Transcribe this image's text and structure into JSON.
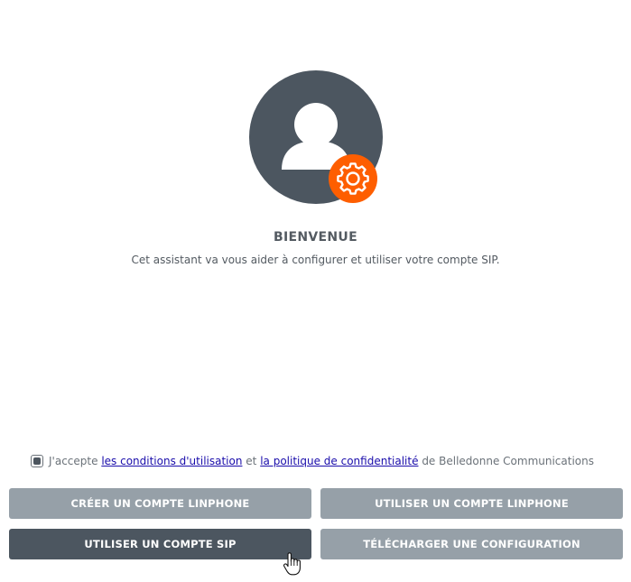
{
  "welcome": {
    "title": "BIENVENUE",
    "subtitle": "Cet assistant va vous aider à configurer et utiliser votre compte SIP."
  },
  "icons": {
    "avatar": "user-avatar-icon",
    "badge": "gear-icon",
    "cursor": "hand-pointer-icon"
  },
  "colors": {
    "avatar_bg": "#4c5660",
    "badge_orange": "#fe5e00",
    "button_light": "#96a0a8",
    "button_dark": "#4c5660",
    "link": "#1a0dab"
  },
  "terms": {
    "checked": true,
    "prefix": "J'accepte",
    "link1": "les conditions d'utilisation",
    "and": "et",
    "link2": "la politique de confidentialité",
    "suffix": "de Belledonne Communications"
  },
  "buttons": {
    "create_linphone": "CRÉER UN COMPTE LINPHONE",
    "use_linphone": "UTILISER UN COMPTE LINPHONE",
    "use_sip": "UTILISER UN COMPTE SIP",
    "download_config": "TÉLÉCHARGER UNE CONFIGURATION"
  }
}
